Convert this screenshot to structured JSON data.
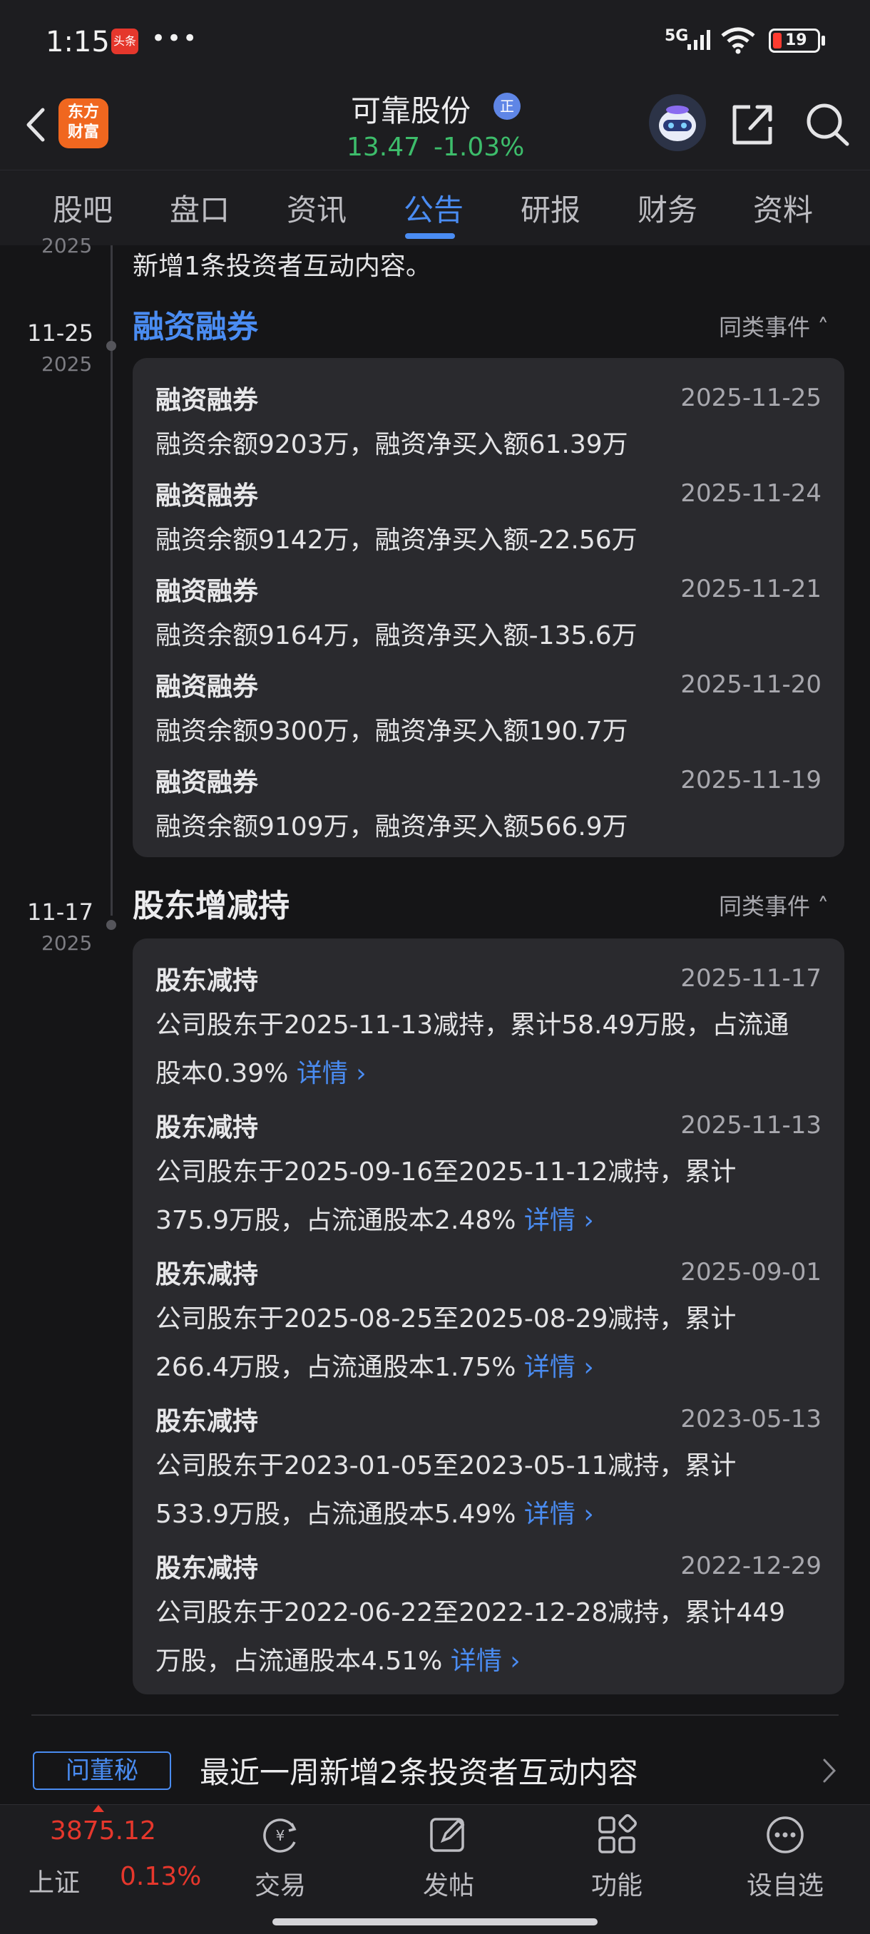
{
  "status_bar": {
    "time": "1:15",
    "app_badge": "头条",
    "dots": "•••",
    "network": "5G",
    "battery": "19"
  },
  "header": {
    "logo_line1": "东方",
    "logo_line2": "财富",
    "stock_name": "可靠股份",
    "badge": "正",
    "price": "13.47",
    "change": "-1.03%"
  },
  "tabs": [
    "股吧",
    "盘口",
    "资讯",
    "公告",
    "研报",
    "财务",
    "资料"
  ],
  "active_tab": "公告",
  "partial": {
    "year": "2025",
    "text": "新增1条投资者互动内容。"
  },
  "sections": [
    {
      "date": "11-25",
      "year": "2025",
      "title": "融资融券",
      "similar": "同类事件",
      "items": [
        {
          "title": "融资融券",
          "date": "2025-11-25",
          "body": "融资余额9203万，融资净买入额61.39万"
        },
        {
          "title": "融资融券",
          "date": "2025-11-24",
          "body": "融资余额9142万，融资净买入额-22.56万"
        },
        {
          "title": "融资融券",
          "date": "2025-11-21",
          "body": "融资余额9164万，融资净买入额-135.6万"
        },
        {
          "title": "融资融券",
          "date": "2025-11-20",
          "body": "融资余额9300万，融资净买入额190.7万"
        },
        {
          "title": "融资融券",
          "date": "2025-11-19",
          "body": "融资余额9109万，融资净买入额566.9万"
        }
      ]
    },
    {
      "date": "11-17",
      "year": "2025",
      "title": "股东增减持",
      "similar": "同类事件",
      "detail_label": "详情",
      "items": [
        {
          "title": "股东减持",
          "date": "2025-11-17",
          "line1": "公司股东于2025-11-13减持，累计58.49万股，占流通",
          "line2": "股本0.39%"
        },
        {
          "title": "股东减持",
          "date": "2025-11-13",
          "line1": "公司股东于2025-09-16至2025-11-12减持，累计",
          "line2": "375.9万股，占流通股本2.48%"
        },
        {
          "title": "股东减持",
          "date": "2025-09-01",
          "line1": "公司股东于2025-08-25至2025-08-29减持，累计",
          "line2": "266.4万股，占流通股本1.75%"
        },
        {
          "title": "股东减持",
          "date": "2023-05-13",
          "line1": "公司股东于2023-01-05至2023-05-11减持，累计",
          "line2": "533.9万股，占流通股本5.49%"
        },
        {
          "title": "股东减持",
          "date": "2022-12-29",
          "line1": "公司股东于2022-06-22至2022-12-28减持，累计449",
          "line2": "万股，占流通股本4.51%"
        }
      ]
    }
  ],
  "dongmi": {
    "tag": "问董秘",
    "text": "最近一周新增2条投资者互动内容"
  },
  "bottom_nav": {
    "index_value": "3875.12",
    "index_name": "上证",
    "index_pct": "0.13%",
    "items": [
      {
        "label": "交易",
        "icon": "trade-icon"
      },
      {
        "label": "发帖",
        "icon": "post-icon"
      },
      {
        "label": "功能",
        "icon": "apps-icon"
      },
      {
        "label": "设自选",
        "icon": "more-icon"
      }
    ]
  }
}
